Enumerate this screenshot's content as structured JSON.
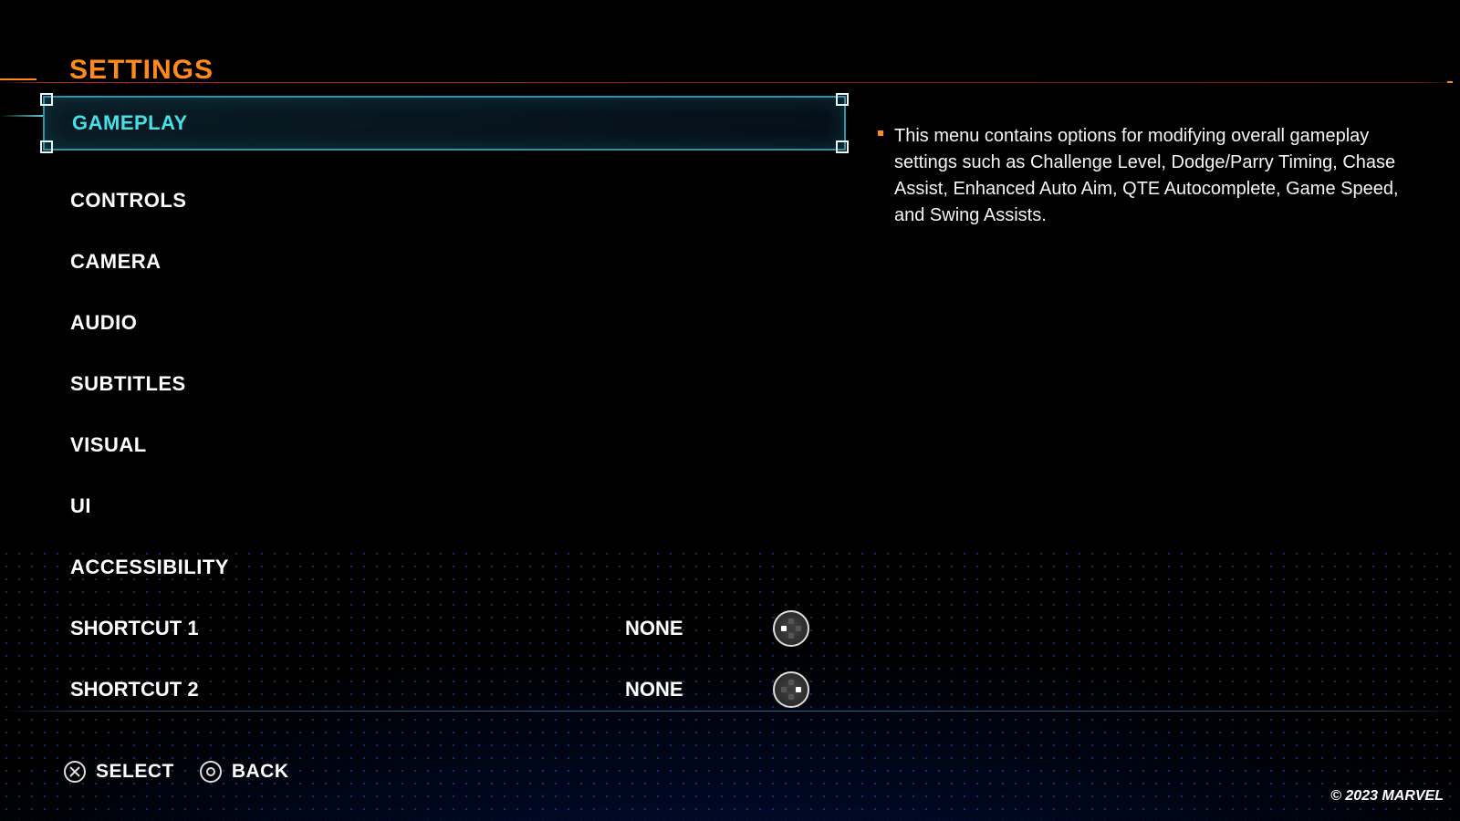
{
  "header": {
    "title": "SETTINGS"
  },
  "menu": {
    "items": [
      {
        "label": "GAMEPLAY",
        "selected": true
      },
      {
        "label": "CONTROLS",
        "selected": false
      },
      {
        "label": "CAMERA",
        "selected": false
      },
      {
        "label": "AUDIO",
        "selected": false
      },
      {
        "label": "SUBTITLES",
        "selected": false
      },
      {
        "label": "VISUAL",
        "selected": false
      },
      {
        "label": "UI",
        "selected": false
      },
      {
        "label": "ACCESSIBILITY",
        "selected": false
      }
    ],
    "shortcuts": [
      {
        "label": "SHORTCUT 1",
        "value": "NONE",
        "dpad_highlight": "l"
      },
      {
        "label": "SHORTCUT 2",
        "value": "NONE",
        "dpad_highlight": "r"
      }
    ]
  },
  "description": {
    "text": "This menu contains options for modifying overall gameplay settings such as Challenge Level, Dodge/Parry Timing, Chase Assist, Enhanced Auto Aim, QTE Autocomplete, Game Speed, and Swing Assists."
  },
  "footer": {
    "select_label": "SELECT",
    "back_label": "BACK"
  },
  "copyright": "© 2023 MARVEL"
}
